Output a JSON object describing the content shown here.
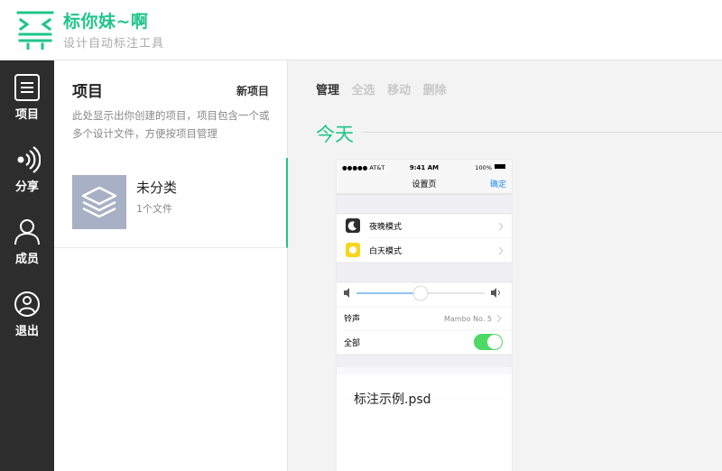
{
  "header": {
    "brand_title": "标你妹~啊",
    "brand_subtitle": "设计自动标注工具"
  },
  "nav": {
    "items": [
      {
        "label": "项目",
        "icon": "project-icon"
      },
      {
        "label": "分享",
        "icon": "share-icon"
      },
      {
        "label": "成员",
        "icon": "member-icon"
      },
      {
        "label": "退出",
        "icon": "logout-icon"
      }
    ]
  },
  "panel": {
    "title": "项目",
    "new_project": "新项目",
    "description": "此处显示出你创建的项目，项目包含一个或多个设计文件，方便按项目管理",
    "projects": [
      {
        "name": "未分类",
        "count": "1个文件"
      }
    ]
  },
  "main": {
    "toolbar": [
      "管理",
      "全选",
      "移动",
      "删除"
    ],
    "section_date": "今天",
    "files": [
      {
        "name": "标注示例.psd",
        "preview": {
          "carrier": "●●●●● AT&T",
          "time": "9:41 AM",
          "battery": "100%",
          "nav_title": "设置页",
          "nav_action": "确定",
          "row_night": "夜晚模式",
          "row_day": "白天模式",
          "row_ringtone": "铃声",
          "ringtone_value": "Mambo No. 5",
          "row_all": "全部"
        }
      }
    ]
  },
  "colors": {
    "accent": "#20c58a",
    "nav_bg": "#2d2d2d",
    "thumb_bg": "#a7b0c4",
    "ios_blue": "#1a8cf0"
  }
}
